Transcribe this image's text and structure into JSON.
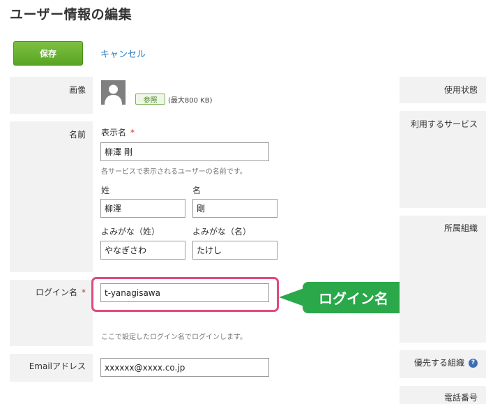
{
  "page": {
    "title": "ユーザー情報の編集"
  },
  "toolbar": {
    "save_label": "保存",
    "cancel_label": "キャンセル"
  },
  "image_row": {
    "label": "画像",
    "browse_label": "参照",
    "max_size": "(最大800 KB)"
  },
  "name_row": {
    "label": "名前",
    "display_name_label": "表示名",
    "display_name_value": "柳澤 剛",
    "display_name_help": "各サービスで表示されるユーザーの名前です。",
    "last_name_label": "姓",
    "last_name_value": "柳澤",
    "first_name_label": "名",
    "first_name_value": "剛",
    "last_kana_label": "よみがな（姓）",
    "last_kana_value": "やなぎさわ",
    "first_kana_label": "よみがな（名）",
    "first_kana_value": "たけし"
  },
  "login_row": {
    "label": "ログイン名",
    "required_mark": "*",
    "value": "t-yanagisawa",
    "help": "ここで設定したログイン名でログインします。"
  },
  "email_row": {
    "label": "Emailアドレス",
    "value": "xxxxxx@xxxx.co.jp"
  },
  "required_mark": "*",
  "callout": {
    "text": "ログイン名"
  },
  "right_panel": {
    "usage_status": "使用状態",
    "services": "利用するサービス",
    "organization": "所属組織",
    "priority_org": "優先する組織",
    "phone": "電話番号"
  },
  "colors": {
    "accent_green": "#5aa423",
    "link_blue": "#2b7bc6",
    "highlight_pink": "#e2487e",
    "callout_green": "#2aa84a"
  }
}
